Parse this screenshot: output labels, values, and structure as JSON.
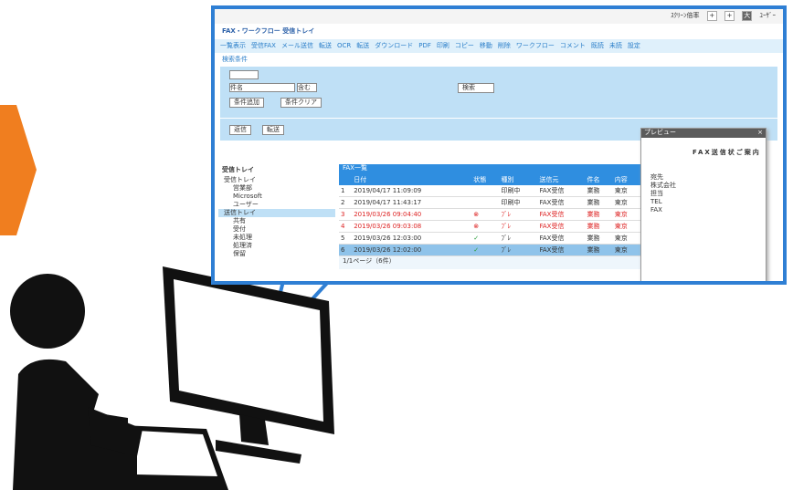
{
  "topbar": {
    "zoom_label": "ｽｸﾘｰﾝ倍率",
    "zoom_in": "+",
    "zoom_plus": "+",
    "zoom_reset": "大",
    "user": "ﾕｰｻﾞｰ"
  },
  "breadcrumb": "FAX・ワークフロー 受信トレイ",
  "menu": [
    "一覧表示",
    "受信FAX",
    "メール送信",
    "転送",
    "OCR",
    "転送",
    "ダウンロード",
    "PDF",
    "印刷",
    "コピー",
    "移動",
    "削除",
    "ワークフロー",
    "コメント",
    "既読",
    "未読",
    "設定"
  ],
  "search": {
    "toggle": "検索条件",
    "field_value": "件名",
    "op_value": "含む",
    "btn_search": "検索",
    "btn_add": "条件追加",
    "btn_clear": "条件クリア"
  },
  "actions": {
    "btn1": "返信",
    "btn2": "転送"
  },
  "tree": {
    "title": "受信トレイ",
    "items": [
      "受信トレイ",
      "営業部",
      "Microsoft",
      "ユーザー",
      "送信トレイ",
      "共有",
      "受付",
      "未処理",
      "処理済",
      "保留"
    ],
    "selected_index": 4
  },
  "grid": {
    "header": "FAX一覧",
    "columns": [
      "",
      "日付",
      "状態",
      "種別",
      "送信元",
      "件名",
      "内容"
    ],
    "rows": [
      {
        "n": "1",
        "date": "2019/04/17 11:09:09",
        "st": "",
        "kind": "印刷中",
        "from": "FAX受信",
        "subject": "業務",
        "body": "東京"
      },
      {
        "n": "2",
        "date": "2019/04/17 11:43:17",
        "st": "",
        "kind": "印刷中",
        "from": "FAX受信",
        "subject": "業務",
        "body": "東京"
      },
      {
        "n": "3",
        "date": "2019/03/26 09:04:40",
        "st": "x",
        "kind": "ﾌﾞﾚ",
        "from": "FAX受信",
        "subject": "業務",
        "body": "東京"
      },
      {
        "n": "4",
        "date": "2019/03/26 09:03:08",
        "st": "x",
        "kind": "ﾌﾞﾚ",
        "from": "FAX受信",
        "subject": "業務",
        "body": "東京"
      },
      {
        "n": "5",
        "date": "2019/03/26 12:03:00",
        "st": "ok",
        "kind": "ﾌﾞﾚ",
        "from": "FAX受信",
        "subject": "業務",
        "body": "東京"
      },
      {
        "n": "6",
        "date": "2019/03/26 12:02:00",
        "st": "ok",
        "kind": "ﾌﾞﾚ",
        "from": "FAX受信",
        "subject": "業務",
        "body": "東京"
      }
    ],
    "pager": "1/1ページ（6件）"
  },
  "preview": {
    "title": "プレビュー",
    "doc_title": "FAX送信状ご案内",
    "lines": [
      "宛先",
      "株式会社",
      "担当",
      "TEL",
      "FAX"
    ]
  },
  "colors": {
    "accent": "#2f7fd4",
    "orange": "#f07e1f",
    "person": "#111111"
  }
}
